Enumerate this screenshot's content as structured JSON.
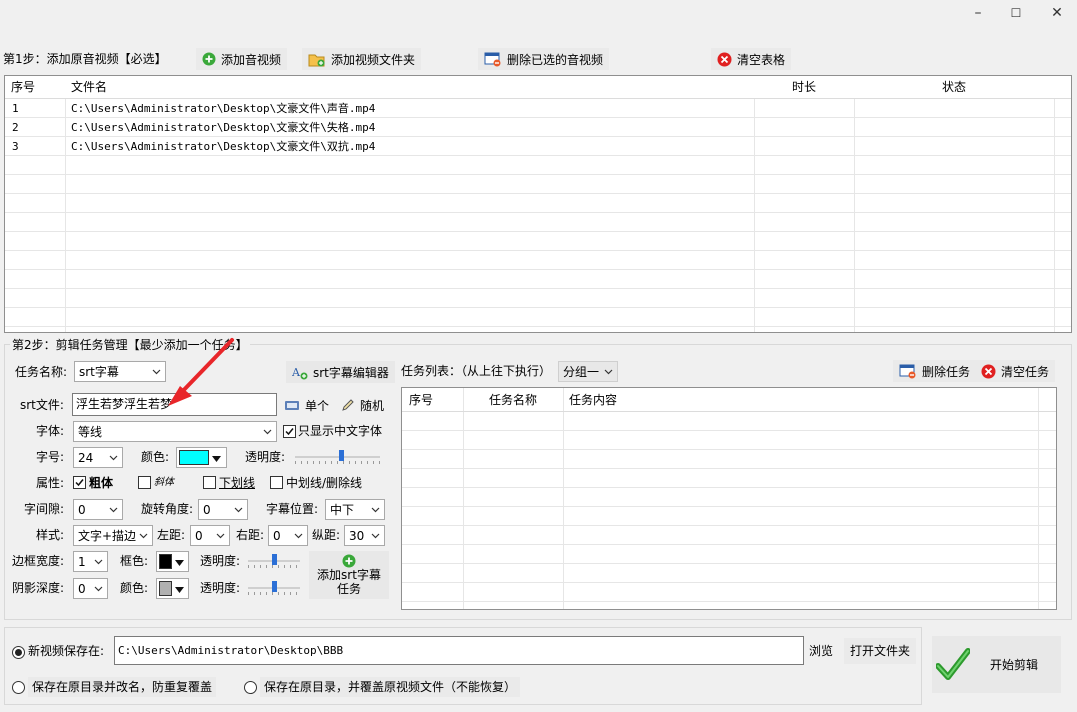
{
  "window": {
    "controls": [
      "–",
      "☐",
      "✕"
    ]
  },
  "step1": {
    "label": "第1步：添加原音视频【必选】",
    "add_av_label": "添加音视频",
    "add_folder_label": "添加视频文件夹",
    "delete_selected_label": "删除已选的音视频",
    "clear_table_label": "清空表格",
    "table": {
      "headers": [
        "序号",
        "文件名",
        "时长",
        "状态"
      ],
      "rows": [
        {
          "index": "1",
          "file": "C:\\Users\\Administrator\\Desktop\\文豪文件\\声音.mp4",
          "duration": "",
          "status": ""
        },
        {
          "index": "2",
          "file": "C:\\Users\\Administrator\\Desktop\\文豪文件\\失格.mp4",
          "duration": "",
          "status": ""
        },
        {
          "index": "3",
          "file": "C:\\Users\\Administrator\\Desktop\\文豪文件\\双抗.mp4",
          "duration": "",
          "status": ""
        }
      ]
    }
  },
  "step2": {
    "label": "第2步：剪辑任务管理【最少添加一个任务】",
    "task_name_label": "任务名称:",
    "task_name_value": "srt字幕",
    "srt_editor_label": "srt字幕编辑器",
    "srt_file_label": "srt文件:",
    "srt_file_value": "浮生若梦浮生若梦",
    "single_label": "单个",
    "random_label": "随机",
    "font_label": "字体:",
    "font_value": "等线",
    "only_chinese_font_label": "只显示中文字体",
    "only_chinese_font_checked": true,
    "size_label": "字号:",
    "size_value": "24",
    "color_label": "颜色:",
    "text_color": "#00ffff",
    "opacity_label": "透明度:",
    "opacity_value": 0.55,
    "attr_label": "属性:",
    "bold_label": "粗体",
    "bold_checked": true,
    "italic_label": "斜体",
    "italic_checked": false,
    "underline_label": "下划线",
    "underline_checked": false,
    "strike_label": "中划线/删除线",
    "strike_checked": false,
    "spacing_label": "字间隙:",
    "spacing_value": "0",
    "rotation_label": "旋转角度:",
    "rotation_value": "0",
    "position_label": "字幕位置:",
    "position_value": "中下",
    "style_label": "样式:",
    "style_value": "文字+描边",
    "left_margin_label": "左距:",
    "left_margin_value": "0",
    "right_margin_label": "右距:",
    "right_margin_value": "0",
    "vertical_margin_label": "纵距:",
    "vertical_margin_value": "30",
    "border_width_label": "边框宽度:",
    "border_width_value": "1",
    "border_color_label": "框色:",
    "border_color": "#000000",
    "border_opacity_label": "透明度:",
    "border_opacity_value": 0.5,
    "shadow_depth_label": "阴影深度:",
    "shadow_depth_value": "0",
    "shadow_color_label": "颜色:",
    "shadow_color": "#b0b0b0",
    "shadow_opacity_label": "透明度:",
    "shadow_opacity_value": 0.5,
    "add_task_label": "添加srt字幕任务",
    "task_list_label": "任务列表：（从上往下执行）",
    "group_value": "分组一",
    "delete_task_label": "删除任务",
    "clear_task_label": "清空任务",
    "task_table": {
      "headers": [
        "序号",
        "任务名称",
        "任务内容"
      ]
    }
  },
  "output": {
    "save_new_label": "新视频保存在:",
    "save_new_checked": true,
    "save_path": "C:\\Users\\Administrator\\Desktop\\BBB",
    "browse_label": "浏览",
    "open_folder_label": "打开文件夹",
    "save_rename_label": "保存在原目录并改名，防重复覆盖",
    "save_overwrite_label": "保存在原目录，并覆盖原视频文件（不能恢复）",
    "start_label": "开始剪辑"
  },
  "colors": {
    "accent_green": "#3aa83a",
    "delete_red": "#e02020",
    "annotation_red": "#e8262a",
    "slider_blue": "#2b6fd6"
  }
}
